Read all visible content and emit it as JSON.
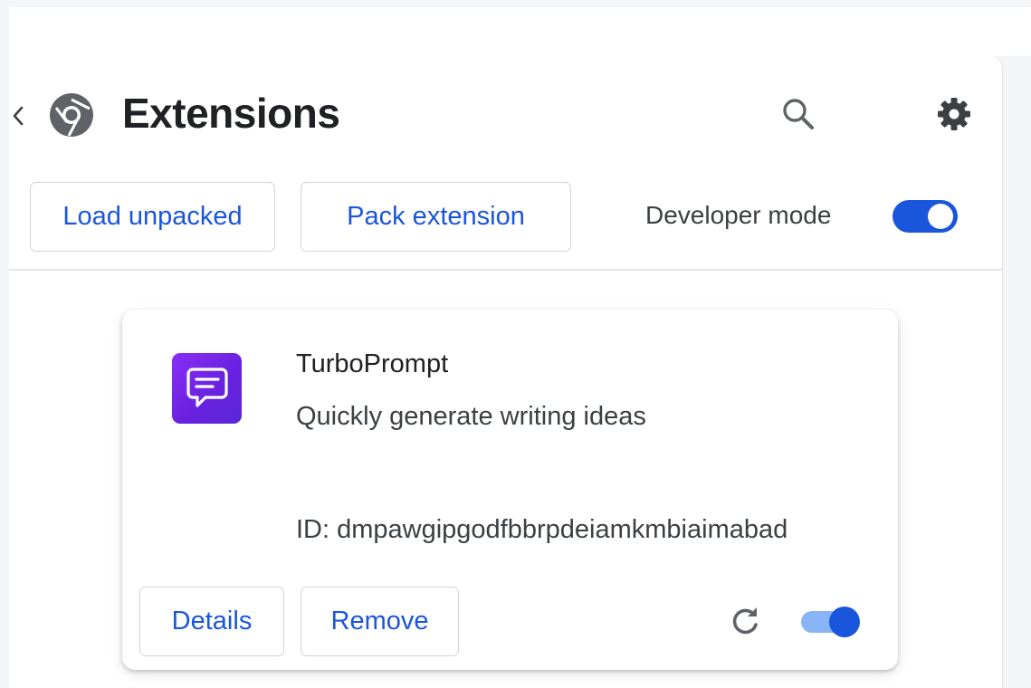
{
  "header": {
    "title": "Extensions",
    "icons": {
      "back": "chevron-left-icon",
      "logo": "chrome-logo-icon",
      "search": "search-icon",
      "settings": "gear-icon"
    }
  },
  "toolbar": {
    "load_unpacked_label": "Load unpacked",
    "pack_extension_label": "Pack extension",
    "developer_mode_label": "Developer mode",
    "developer_mode_on": true
  },
  "extension": {
    "name": "TurboPrompt",
    "description": "Quickly generate writing ideas",
    "id_text": "ID: dmpawgipgodfbbrpdeiamkmbiaimabad",
    "details_label": "Details",
    "remove_label": "Remove",
    "enabled": true,
    "icon": "chat-bubble-icon"
  },
  "colors": {
    "accent_blue": "#1a56db",
    "toggle_track_on": "#1a56db",
    "toggle_track_light": "#8ab4f8",
    "icon_gradient_start": "#8a2ef5",
    "icon_gradient_end": "#5b25d6",
    "text_primary": "#202124"
  }
}
